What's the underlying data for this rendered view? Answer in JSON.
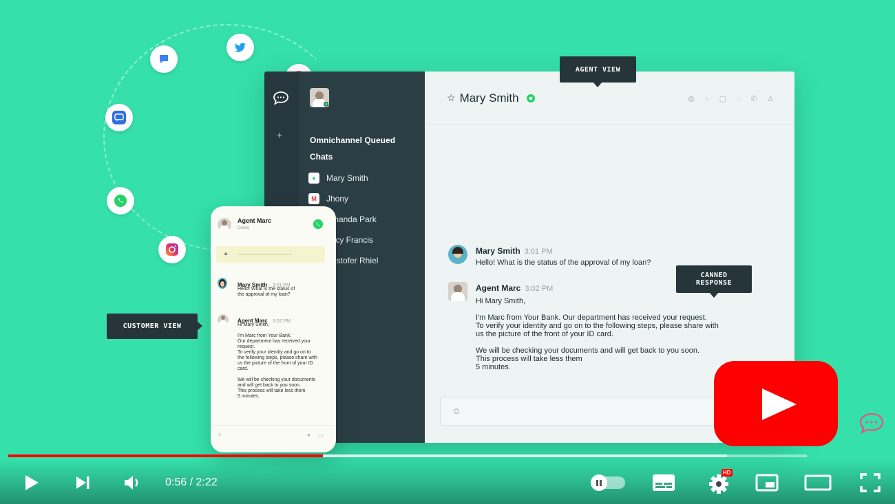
{
  "agent_window": {
    "contact_name": "Mary Smith",
    "star_icon": "☆",
    "queue_title_line1": "Omnichannel Queued",
    "queue_title_line2": "Chats",
    "queue": [
      {
        "name": "Mary Smith",
        "icon": "whatsapp-icon",
        "color": "#25d366"
      },
      {
        "name": "Jhony",
        "icon": "gmail-icon",
        "color": "#ea4335"
      },
      {
        "name": "Amanda Park",
        "icon": "messenger-icon",
        "color": "#3b82f6"
      },
      {
        "name": "Lucy Francis",
        "icon": "chat-icon",
        "color": "#3b82f6"
      },
      {
        "name": "Kristofer Rhiel",
        "icon": "chat-icon",
        "color": "#3b82f6"
      }
    ],
    "messages": [
      {
        "name": "Mary Smith",
        "time": "3:01 PM",
        "text": "Hello! What is the status of the approval of my loan?"
      },
      {
        "name": "Agent Marc",
        "time": "3:02 PM",
        "text": "Hi Mary Smith,\n\nI'm Marc from Your Bank. Our department has received your request.\nTo verify your identity and go on to the following steps, please share with\nus the picture of the front of your ID card.\n\nWe will be checking your  documents and will get back to you soon.\nThis process will take less them\n5 minutes."
      }
    ]
  },
  "phone": {
    "agent_name": "Agent Marc",
    "status": "Online",
    "messages": [
      {
        "name": "Mary Smith",
        "time": "3:01 PM",
        "text": "Hello! What is the status of\nthe approval of my loan?"
      },
      {
        "name": "Agent Marc",
        "time": "3:02 PM",
        "text": "Hi Mary Smith,\n\nI'm Marc from Your Bank.\nOur department has received your\nrequest.\nTo verify your identity and go on to\nthe following steps, please share with\nus the picture of the front of your ID\ncard.\n\nWe will be checking your  documents\nand will get back to you soon.\nThis process will take less them\n5 minutes."
      }
    ]
  },
  "tags": {
    "agent_view": "AGENT VIEW",
    "customer_view": "CUSTOMER VIEW",
    "canned_response_line1": "CANNED",
    "canned_response_line2": "RESPONSE"
  },
  "player": {
    "current_time": "0:56",
    "duration": "2:22",
    "time_display": "0:56 / 2:22",
    "progress": 0.394,
    "buffered": 0.9,
    "hd_badge": "HD",
    "brand_color": "#ff0000"
  }
}
